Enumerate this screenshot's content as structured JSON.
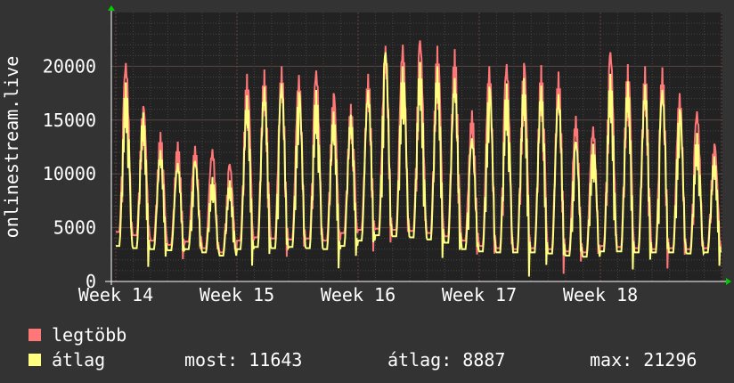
{
  "chart_data": {
    "type": "area",
    "title": "",
    "ylabel": "onlinestream.live",
    "xlabel": "",
    "ylim": [
      0,
      25000
    ],
    "yticks": [
      0,
      5000,
      10000,
      15000,
      20000
    ],
    "xticks": [
      "Week 14",
      "Week 15",
      "Week 16",
      "Week 17",
      "Week 18"
    ],
    "grid": true,
    "x_unit": "day",
    "x_range_days": [
      0,
      35
    ],
    "series": [
      {
        "name": "legtöbb",
        "color": "#ff7777",
        "daily": [
          {
            "min": 4600,
            "peak": 20300
          },
          {
            "min": 4300,
            "peak": 16300
          },
          {
            "min": 3800,
            "peak": 13900
          },
          {
            "min": 3400,
            "peak": 13000
          },
          {
            "min": 3700,
            "peak": 12600
          },
          {
            "min": 3100,
            "peak": 12300
          },
          {
            "min": 2700,
            "peak": 10900
          },
          {
            "min": 3800,
            "peak": 19300
          },
          {
            "min": 4100,
            "peak": 19700
          },
          {
            "min": 4000,
            "peak": 20000
          },
          {
            "min": 3900,
            "peak": 19200
          },
          {
            "min": 4000,
            "peak": 19600
          },
          {
            "min": 3800,
            "peak": 17500
          },
          {
            "min": 4500,
            "peak": 16500
          },
          {
            "min": 4800,
            "peak": 19300
          },
          {
            "min": 4900,
            "peak": 21900
          },
          {
            "min": 4800,
            "peak": 22000
          },
          {
            "min": 4700,
            "peak": 22400
          },
          {
            "min": 4500,
            "peak": 21900
          },
          {
            "min": 4200,
            "peak": 21600
          },
          {
            "min": 3800,
            "peak": 15900
          },
          {
            "min": 3300,
            "peak": 20000
          },
          {
            "min": 3100,
            "peak": 20200
          },
          {
            "min": 3000,
            "peak": 20300
          },
          {
            "min": 3100,
            "peak": 20100
          },
          {
            "min": 3000,
            "peak": 19500
          },
          {
            "min": 2800,
            "peak": 15400
          },
          {
            "min": 2700,
            "peak": 14400
          },
          {
            "min": 3300,
            "peak": 21300
          },
          {
            "min": 3200,
            "peak": 20200
          },
          {
            "min": 3100,
            "peak": 20000
          },
          {
            "min": 3000,
            "peak": 19900
          },
          {
            "min": 3100,
            "peak": 17500
          },
          {
            "min": 3000,
            "peak": 15800
          },
          {
            "min": 3100,
            "peak": 12800
          }
        ]
      },
      {
        "name": "átlag",
        "color": "#ffff80",
        "daily": [
          {
            "min": 3300,
            "peak": 18500
          },
          {
            "min": 3100,
            "peak": 15700
          },
          {
            "min": 3000,
            "peak": 12200
          },
          {
            "min": 2900,
            "peak": 11000
          },
          {
            "min": 3000,
            "peak": 11200
          },
          {
            "min": 2700,
            "peak": 9700
          },
          {
            "min": 2400,
            "peak": 9400
          },
          {
            "min": 3000,
            "peak": 17300
          },
          {
            "min": 3200,
            "peak": 18100
          },
          {
            "min": 3100,
            "peak": 18400
          },
          {
            "min": 3200,
            "peak": 17600
          },
          {
            "min": 3100,
            "peak": 17800
          },
          {
            "min": 3000,
            "peak": 15800
          },
          {
            "min": 3300,
            "peak": 15500
          },
          {
            "min": 3800,
            "peak": 17800
          },
          {
            "min": 4300,
            "peak": 21300
          },
          {
            "min": 4200,
            "peak": 20000
          },
          {
            "min": 4100,
            "peak": 20400
          },
          {
            "min": 3900,
            "peak": 20000
          },
          {
            "min": 3600,
            "peak": 18900
          },
          {
            "min": 3000,
            "peak": 13300
          },
          {
            "min": 2800,
            "peak": 18100
          },
          {
            "min": 2700,
            "peak": 18400
          },
          {
            "min": 2700,
            "peak": 18900
          },
          {
            "min": 2700,
            "peak": 18200
          },
          {
            "min": 2600,
            "peak": 17400
          },
          {
            "min": 2400,
            "peak": 13000
          },
          {
            "min": 2300,
            "peak": 12800
          },
          {
            "min": 2800,
            "peak": 19300
          },
          {
            "min": 2800,
            "peak": 18600
          },
          {
            "min": 2700,
            "peak": 18300
          },
          {
            "min": 2700,
            "peak": 17800
          },
          {
            "min": 2700,
            "peak": 16000
          },
          {
            "min": 2600,
            "peak": 13800
          },
          {
            "min": 2700,
            "peak": 11643
          }
        ]
      }
    ]
  },
  "legend": {
    "items": [
      {
        "label": "legtöbb",
        "color": "#ff7777"
      },
      {
        "label": "átlag",
        "color": "#ffff80"
      }
    ]
  },
  "stats": {
    "current": "most: 11643",
    "average": "átlag: 8887",
    "max": "max: 21296"
  }
}
